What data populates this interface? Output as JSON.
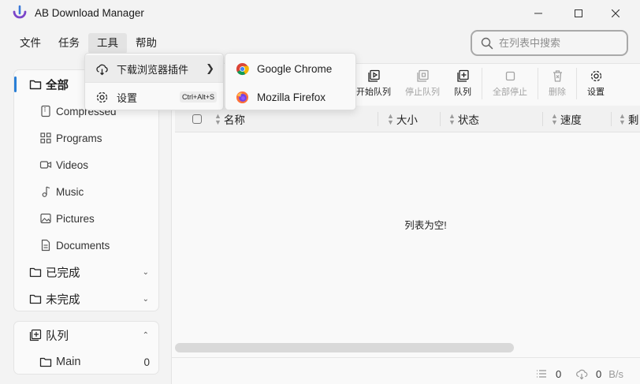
{
  "app": {
    "title": "AB Download Manager"
  },
  "menubar": [
    "文件",
    "任务",
    "工具",
    "帮助"
  ],
  "search": {
    "placeholder": "在列表中搜索"
  },
  "tools_menu": {
    "browser_plugins": "下载浏览器插件",
    "settings": "设置",
    "settings_shortcut": "Ctrl+Alt+S"
  },
  "browsers_menu": [
    "Google Chrome",
    "Mozilla Firefox"
  ],
  "toolbar": {
    "start_queue": "开始队列",
    "stop_queue": "停止队列",
    "queue": "队列",
    "stop_all": "全部停止",
    "delete": "删除",
    "settings": "设置"
  },
  "sidebar": {
    "all": "全部",
    "categories": [
      "Compressed",
      "Programs",
      "Videos",
      "Music",
      "Pictures",
      "Documents"
    ],
    "finished": "已完成",
    "unfinished": "未完成",
    "queues_title": "队列",
    "queues": [
      {
        "name": "Main",
        "count": "0"
      }
    ]
  },
  "table": {
    "columns": [
      "名称",
      "大小",
      "状态",
      "速度",
      "剩"
    ],
    "empty_message": "列表为空!"
  },
  "footer": {
    "active_count": "0",
    "speed": "0",
    "speed_unit": "B/s"
  },
  "colors": {
    "accent": "#2a7fd6",
    "app_icon": "#7b45c9"
  }
}
